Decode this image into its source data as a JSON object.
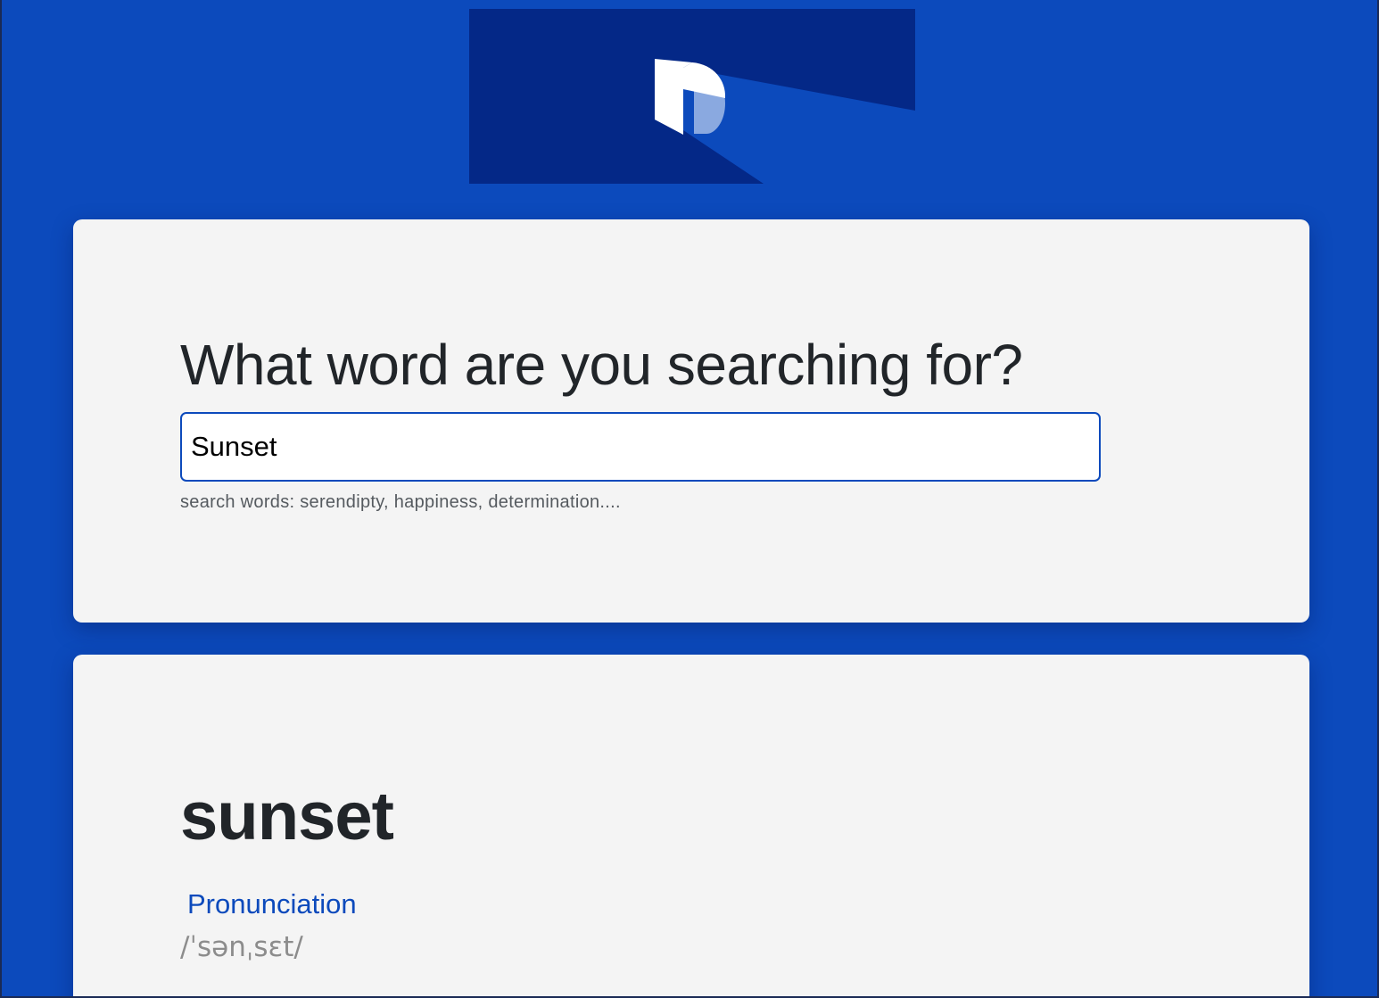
{
  "colors": {
    "background": "#0c4abc",
    "card": "#f4f4f4",
    "accent": "#0c4abc",
    "heading": "#212529",
    "muted": "#8c8c8c"
  },
  "logo": {
    "icon": "dictionary-d-logo-icon"
  },
  "search": {
    "heading": "What word are you searching for?",
    "value": "Sunset",
    "hint": "search words: serendipty, happiness, determination...."
  },
  "result": {
    "word": "sunset",
    "pronunciation_label": "Pronunciation",
    "phonetic": "/ˈsənˌsɛt/"
  }
}
